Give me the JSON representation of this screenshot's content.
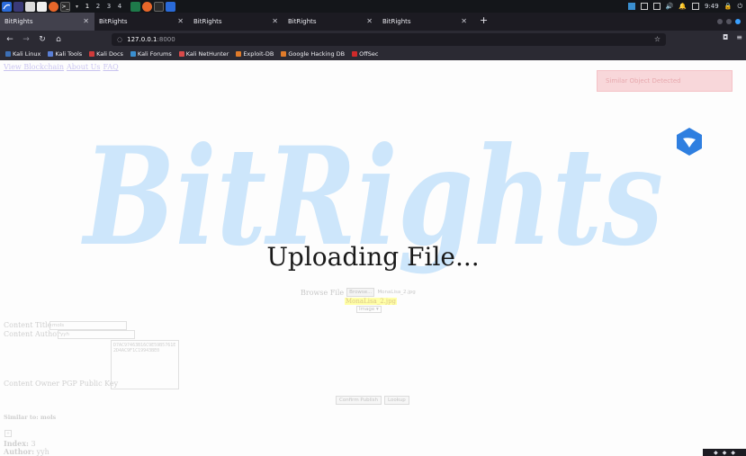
{
  "taskbar": {
    "workspaces": [
      "1",
      "2",
      "3",
      "4"
    ],
    "clock": "9:49",
    "apps": [
      "kali-menu-icon",
      "terminal-icon",
      "files-icon",
      "firefox-icon",
      "terminal-icon"
    ]
  },
  "browser": {
    "tabs": [
      {
        "title": "BitRights"
      },
      {
        "title": "BitRights"
      },
      {
        "title": "BitRights"
      },
      {
        "title": "BitRights"
      },
      {
        "title": "BitRights"
      }
    ],
    "url_host": "127.0.0.1",
    "url_port": ":8000",
    "bookmarks": [
      {
        "label": "Kali Linux",
        "color": "#3c6fb5"
      },
      {
        "label": "Kali Tools",
        "color": "#5a7fd6"
      },
      {
        "label": "Kali Docs",
        "color": "#d03a3a"
      },
      {
        "label": "Kali Forums",
        "color": "#3a8fd0"
      },
      {
        "label": "Kali NetHunter",
        "color": "#d94a4a"
      },
      {
        "label": "Exploit-DB",
        "color": "#e07b2a"
      },
      {
        "label": "Google Hacking DB",
        "color": "#e07b2a"
      },
      {
        "label": "OffSec",
        "color": "#d02a2a"
      }
    ]
  },
  "page": {
    "nav_links": [
      "View Blockchain",
      "About Us",
      "FAQ"
    ],
    "alert_text": "Similar Object Detected",
    "logo_text": "BitRights",
    "overlay_title": "Uploading File...",
    "browse_label": "Browse File",
    "browse_button": "Browse...",
    "selected_file": "MonaLisa_2.jpg",
    "highlight_text": "MonaLisa_2.jpg",
    "type_select": "Image",
    "content_title_label": "Content Title",
    "content_title_value": "mols",
    "content_author_label": "Content Author",
    "content_author_value": "yyh",
    "pgp_label": "Content Owner PGP Public Key",
    "pgp_value": "D7AC97463B16C9E59B5761E2D4AC9F1C19943BE0",
    "confirm_button": "Confirm Publish",
    "lookup_button": "Lookup",
    "similar_heading": "Similar to: mols",
    "index_label": "Index:",
    "index_value": "3",
    "author_label": "Author:",
    "author_value": "yyh"
  },
  "colors": {
    "logo": "#cde6fb",
    "alert_bg": "#f8d7da",
    "highlight": "#ffffa8",
    "tab_active": "#42414d",
    "toolbar": "#2b2a33"
  }
}
